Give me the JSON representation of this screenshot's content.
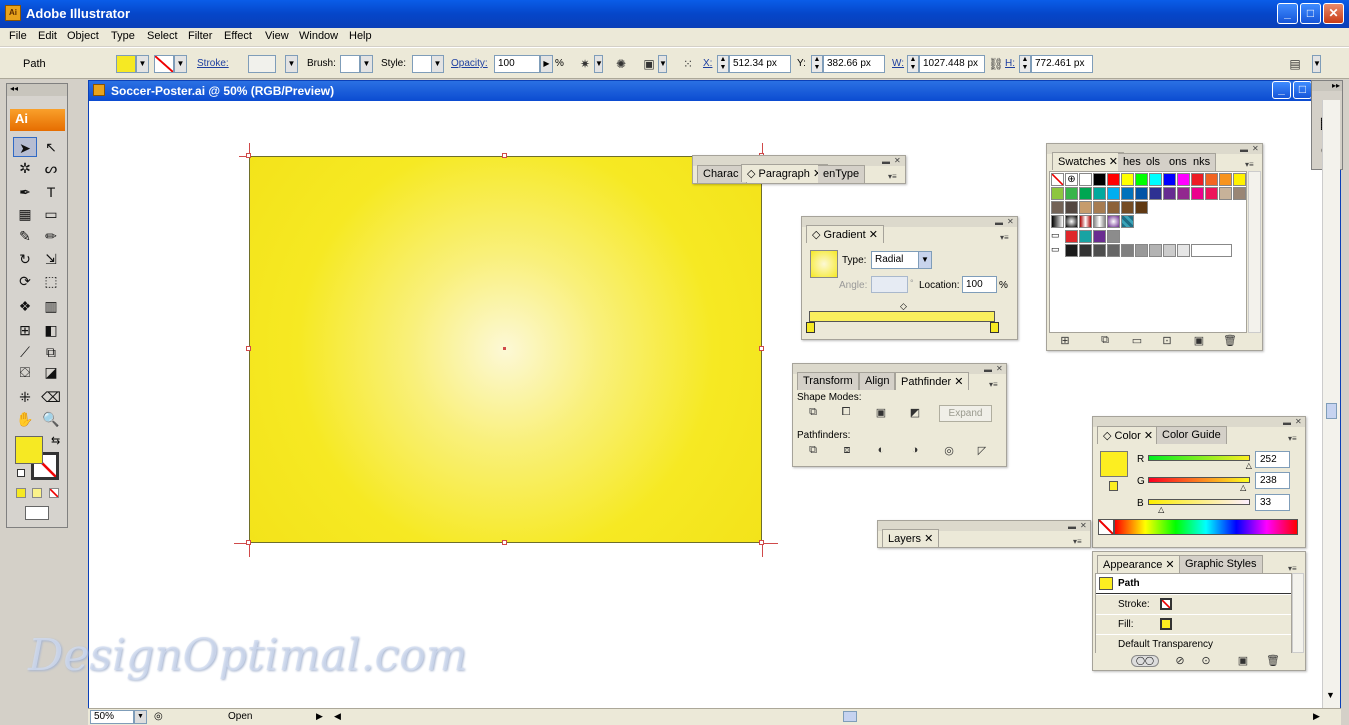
{
  "app": {
    "title": "Adobe Illustrator",
    "icon_label": "Ai",
    "window_buttons": [
      "minimize-icon",
      "restore-icon",
      "close-icon"
    ]
  },
  "menu": [
    "File",
    "Edit",
    "Object",
    "Type",
    "Select",
    "Filter",
    "Effect",
    "View",
    "Window",
    "Help"
  ],
  "control_bar": {
    "selection_label": "Path",
    "stroke_label": "Stroke:",
    "brush_label": "Brush:",
    "style_label": "Style:",
    "opacity_label": "Opacity:",
    "opacity_value": "100",
    "percent": "%",
    "x_label": "X:",
    "x_value": "512.34 px",
    "y_label": "Y:",
    "y_value": "382.66 px",
    "w_label": "W:",
    "w_value": "1027.448 px",
    "h_label": "H:",
    "h_value": "772.461 px"
  },
  "tools": {
    "logo": "Ai"
  },
  "document": {
    "title": "Soccer-Poster.ai @ 50% (RGB/Preview)",
    "fill_color": "#f6e923"
  },
  "char_panel": {
    "tabs": [
      "Charac",
      "Paragraph",
      "enType"
    ]
  },
  "gradient_panel": {
    "tab": "Gradient",
    "type_label": "Type:",
    "type_value": "Radial",
    "angle_label": "Angle:",
    "angle_unit": "°",
    "location_label": "Location:",
    "location_value": "100",
    "percent": "%"
  },
  "pathfinder_panel": {
    "tabs": [
      "Transform",
      "Align",
      "Pathfinder"
    ],
    "shape_modes_label": "Shape Modes:",
    "expand_label": "Expand",
    "pathfinders_label": "Pathfinders:"
  },
  "swatches_panel": {
    "tabs": [
      "Swatches",
      "hes",
      "ols",
      "ons",
      "nks"
    ],
    "colors": [
      "#ffffff",
      "#000000",
      "#ff0000",
      "#ffff00",
      "#00ff00",
      "#00ffff",
      "#0000ff",
      "#ff00ff",
      "#ed1c24",
      "#f26522",
      "#f7941d",
      "#fff200",
      "#8dc63f",
      "#39b54a",
      "#00a651",
      "#00a99d",
      "#00aeef",
      "#0072bc",
      "#0054a6",
      "#2e3192",
      "#662d91",
      "#92278f",
      "#ec008c",
      "#ed145b",
      "#c7b299",
      "#998675",
      "#736357",
      "#534741",
      "#c69c6d",
      "#a67c52",
      "#8c6239",
      "#754c24",
      "#603913"
    ],
    "greys": [
      "#1a1a1a",
      "#333333",
      "#4d4d4d",
      "#666666",
      "#808080",
      "#999999",
      "#b3b3b3",
      "#cccccc",
      "#e6e6e6"
    ]
  },
  "color_panel": {
    "tabs": [
      "Color",
      "Color Guide"
    ],
    "r_label": "R",
    "r_value": "252",
    "g_label": "G",
    "g_value": "238",
    "b_label": "B",
    "b_value": "33",
    "r_fraction": 0.988,
    "g_fraction": 0.933,
    "b_fraction": 0.129
  },
  "layers_panel": {
    "tab": "Layers"
  },
  "appearance_panel": {
    "tabs": [
      "Appearance",
      "Graphic Styles"
    ],
    "title": "Path",
    "stroke_label": "Stroke:",
    "fill_label": "Fill:",
    "transparency_label": "Default Transparency"
  },
  "status": {
    "zoom": "50%",
    "open": "Open"
  },
  "watermark": "DesignOptimal.com"
}
